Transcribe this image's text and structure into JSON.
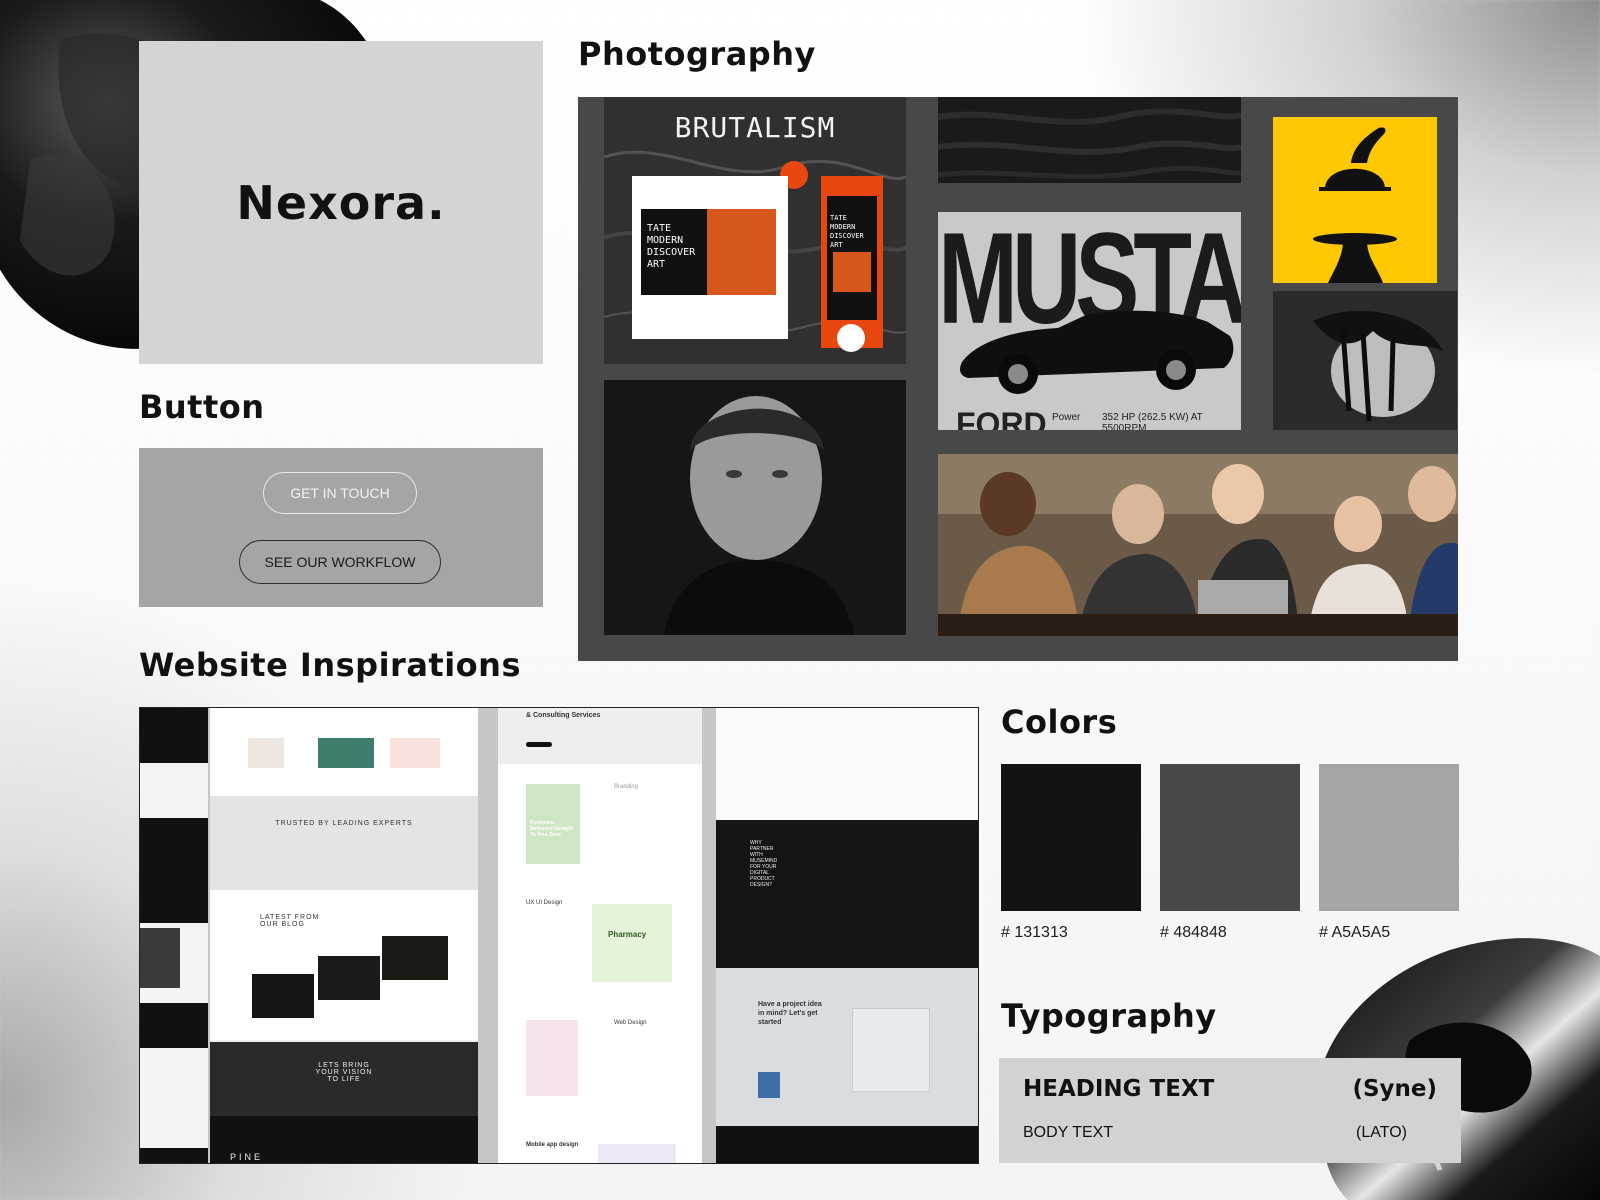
{
  "brand": {
    "logo_text": "Nexora."
  },
  "sections": {
    "photography": "Photography",
    "button": "Button",
    "website_inspirations": "Website Inspirations",
    "colors": "Colors",
    "typography": "Typography"
  },
  "buttons": {
    "primary_label": "GET IN TOUCH",
    "secondary_label": "SEE OUR WORKFLOW"
  },
  "photography": {
    "brutalism": {
      "title": "BRUTALISM",
      "poster_text": "TATE MODERN DISCOVER ART",
      "phone_text": "TATE MODERN DISCOVER ART"
    },
    "mustang": {
      "title": "MUSTANG",
      "brand": "FORD",
      "power_label": "Power",
      "spec": "352 HP (262.5 KW) AT 5500RPM"
    }
  },
  "website_inspirations": {
    "pine": {
      "trusted": "TRUSTED BY LEADING EXPERTS",
      "blog": "LATEST FROM OUR BLOG",
      "vision": "LETS BRING YOUR VISION TO LIFE",
      "logo": "PINE"
    },
    "services": {
      "heading": "& Consulting Services",
      "branding": "Branding",
      "branding_card": "Freshness Delivered Straight To Your Door",
      "ux": "UX UI Design",
      "pharmacy": "Pharmacy",
      "web": "Web Design",
      "mobile": "Mobile app design"
    },
    "musemind": {
      "why": "WHY PARTNER WITH MUSEMIND FOR YOUR DIGITAL PRODUCT DESIGN?",
      "project": "Have a project idea in mind? Let's get started"
    }
  },
  "colors": {
    "swatches": [
      {
        "hex": "#131313",
        "label": "# 131313"
      },
      {
        "hex": "#484848",
        "label": "# 484848"
      },
      {
        "hex": "#A5A5A5",
        "label": "# A5A5A5"
      }
    ]
  },
  "typography": {
    "heading_label": "HEADING TEXT",
    "heading_font": "(Syne)",
    "body_label": "BODY TEXT",
    "body_font": "(LATO)"
  }
}
